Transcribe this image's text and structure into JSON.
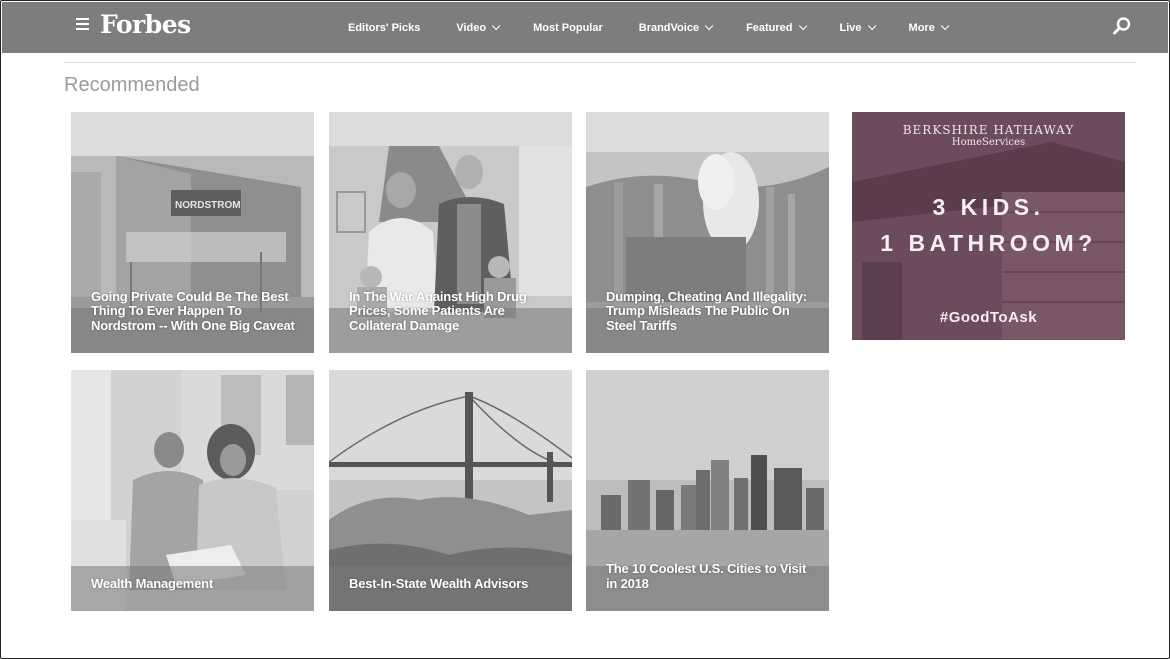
{
  "header": {
    "logo": "Forbes",
    "nav": [
      {
        "label": "Editors' Picks",
        "dropdown": false
      },
      {
        "label": "Video",
        "dropdown": true
      },
      {
        "label": "Most Popular",
        "dropdown": false
      },
      {
        "label": "BrandVoice",
        "dropdown": true
      },
      {
        "label": "Featured",
        "dropdown": true
      },
      {
        "label": "Live",
        "dropdown": true
      },
      {
        "label": "More",
        "dropdown": true
      }
    ]
  },
  "section": {
    "title": "Recommended"
  },
  "cards": [
    {
      "title": "Going Private Could Be The Best Thing To Ever Happen To Nordstrom -- With One Big Caveat",
      "image": "nordstrom-storefront"
    },
    {
      "title": "In The War Against High Drug Prices, Some Patients Are Collateral Damage",
      "image": "family-portrait"
    },
    {
      "title": "Dumping, Cheating And Illegality: Trump Misleads The Public On Steel Tariffs",
      "image": "steel-mill"
    },
    {
      "title": "Wealth Management",
      "image": "women-reviewing-documents"
    },
    {
      "title": "Best-In-State Wealth Advisors",
      "image": "golden-gate-bridge"
    },
    {
      "title": "The 10 Coolest U.S. Cities to Visit in 2018",
      "image": "city-skyline"
    }
  ],
  "ad": {
    "brand": "BERKSHIRE HATHAWAY",
    "brand_sub": "HomeServices",
    "headline_line1": "3 KIDS.",
    "headline_line2": "1 BATHROOM?",
    "hashtag": "#GoodToAsk"
  },
  "colors": {
    "nav_bg": "#7d7d7d",
    "ad_bg": "#6b4a5c",
    "section_title": "#9b9b9b"
  }
}
